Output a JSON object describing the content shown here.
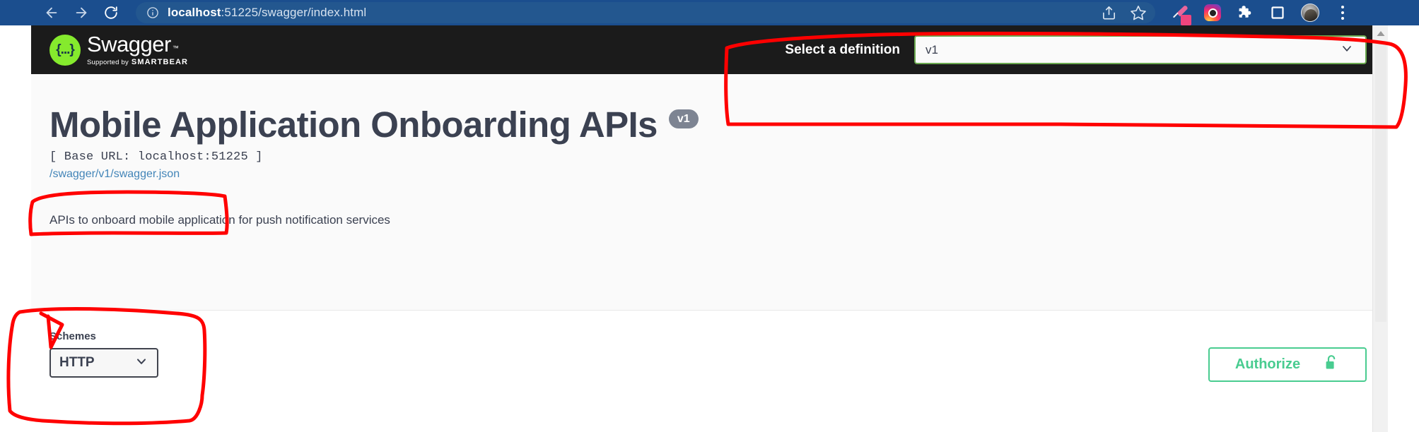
{
  "browser": {
    "url_host": "localhost",
    "url_rest": ":51225/swagger/index.html",
    "back_icon": "back-arrow-icon",
    "forward_icon": "forward-arrow-icon",
    "reload_icon": "reload-icon",
    "info_icon": "site-info-icon",
    "share_icon": "share-icon",
    "bookmark_icon": "star-icon",
    "eyedropper_icon": "eyedropper-icon",
    "instagram_icon": "instagram-extension-icon",
    "extensions_icon": "puzzle-piece-icon",
    "collections_icon": "collections-icon",
    "profile_icon": "avatar-icon",
    "menu_icon": "kebab-menu-icon",
    "chrome_color": "#1b4e8e"
  },
  "topbar": {
    "logo_glyph": "{...}",
    "logo_word": "Swagger",
    "logo_tm": "™",
    "supported_by": "Supported by",
    "smartbear": "SMARTBEAR",
    "definition_label": "Select a definition",
    "definition_value": "v1",
    "definition_border_color": "#6aa84f",
    "background": "#1b1b1b",
    "logo_green": "#85ea2d"
  },
  "info": {
    "title": "Mobile Application Onboarding APIs",
    "version_badge": "v1",
    "base_url": "[ Base URL: localhost:51225 ]",
    "spec_link": "/swagger/v1/swagger.json",
    "description": "APIs to onboard mobile application for push notification services",
    "link_color": "#4385b8",
    "text_color": "#3b4151"
  },
  "controls": {
    "schemes_label": "Schemes",
    "schemes_value": "HTTP",
    "authorize_label": "Authorize",
    "authorize_icon": "unlock-icon",
    "authorize_color": "#49cc90"
  },
  "scrollbar": {
    "up_icon": "scroll-up-arrow-icon"
  },
  "annotations": {
    "color": "#ff0000",
    "shapes": [
      "definition-selector-highlight",
      "base-url-highlight",
      "schemes-highlight"
    ]
  }
}
